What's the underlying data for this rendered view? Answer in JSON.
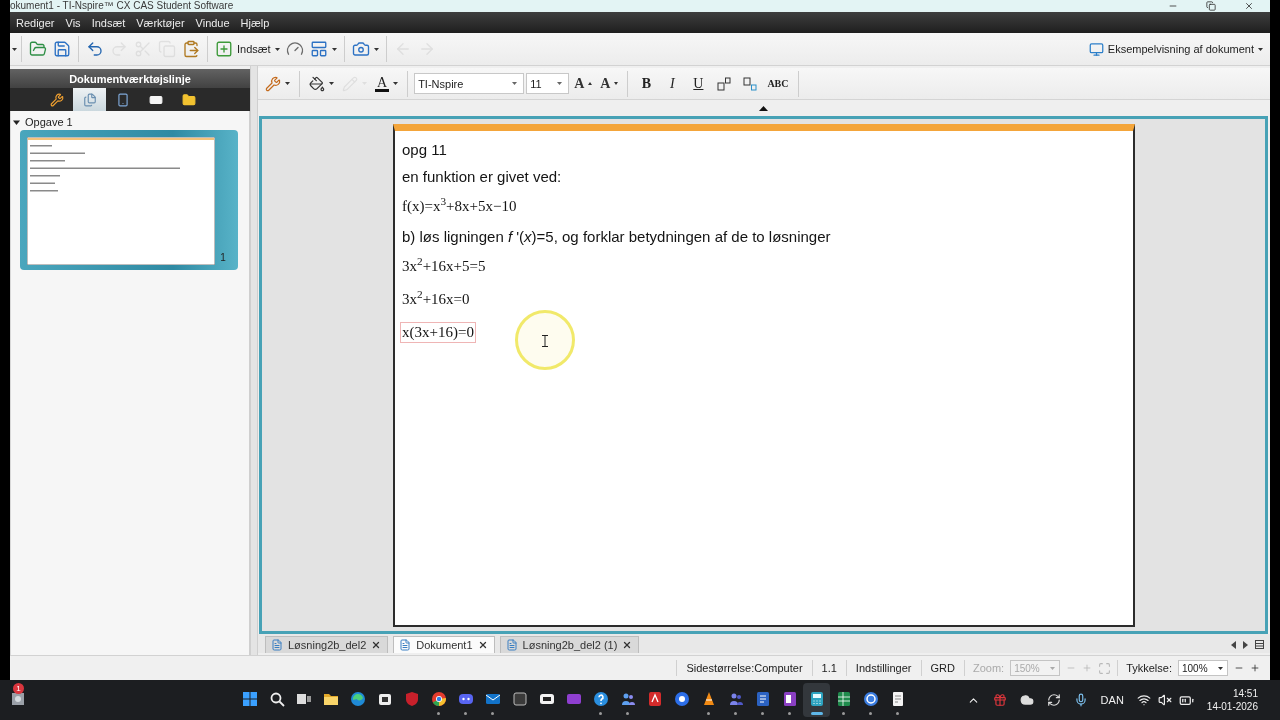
{
  "window": {
    "title": "okument1 - TI-Nspire™ CX CAS Student Software"
  },
  "menu_bar": [
    "Rediger",
    "Vis",
    "Indsæt",
    "Værktøjer",
    "Vindue",
    "Hjælp"
  ],
  "toolbar": {
    "buttons": [
      {
        "disabled": false,
        "menu": false
      },
      {
        "disabled": false,
        "menu": false
      },
      {
        "disabled": false,
        "menu": false
      },
      {
        "disabled": true,
        "menu": false
      },
      {
        "disabled": true,
        "menu": false
      },
      {
        "disabled": true,
        "menu": false
      },
      {
        "disabled": false,
        "menu": false
      },
      {
        "label": "Indsæt",
        "disabled": false,
        "menu": true
      },
      {
        "disabled": false,
        "menu": false
      },
      {
        "disabled": false,
        "menu": true
      },
      {
        "disabled": false,
        "menu": true
      },
      {
        "disabled": true,
        "menu": false
      },
      {
        "disabled": true,
        "menu": false
      }
    ],
    "preview": {
      "label": "Eksempelvisning af dokument",
      "menu": true
    }
  },
  "document_toolbar": {
    "title": "Dokumentværktøjslinje",
    "tabs": [
      {
        "selected": false
      },
      {
        "selected": true
      },
      {
        "selected": false
      },
      {
        "selected": false
      },
      {
        "selected": false
      }
    ]
  },
  "page_sorter": {
    "problems": [
      {
        "label": "Opgave 1",
        "expanded": true,
        "pages": [
          {
            "number": "1",
            "selected": true
          }
        ]
      }
    ]
  },
  "format_toolbar": {
    "tools": [
      {
        "disabled": false
      },
      {
        "disabled": false
      },
      {
        "disabled": true
      },
      {
        "label": "A",
        "disabled": false
      }
    ],
    "font": "TI-Nspire",
    "size": "11",
    "size_buttons": [
      {
        "label": "A",
        "kind": "grow"
      },
      {
        "label": "A",
        "kind": "shrink"
      }
    ],
    "style_buttons": [
      {
        "label": "B",
        "kind": "bold"
      },
      {
        "label": "I",
        "kind": "italic"
      },
      {
        "label": "U",
        "kind": "underline"
      }
    ],
    "script_buttons": [
      {
        "kind": "superscript"
      },
      {
        "kind": "subscript"
      }
    ],
    "spell_label": "ABC"
  },
  "document": {
    "lines": [
      {
        "kind": "text",
        "text": "opg 11",
        "focused": false
      },
      {
        "kind": "text",
        "text": "en funktion er givet ved:",
        "focused": false
      },
      {
        "kind": "math",
        "text": "f(x)=x$^{3}$+8x+5x−10",
        "focused": false
      },
      {
        "kind": "text",
        "text": "b) løs ligningen *f* '(*x*)=5, og forklar betydningen af de to løsninger",
        "focused": false
      },
      {
        "kind": "math",
        "text": "3x$^{2}$+16x+5=5",
        "focused": false
      },
      {
        "kind": "math",
        "text": "3x$^{2}$+16x=0",
        "focused": false
      },
      {
        "kind": "math",
        "text": "x(3x+16)=0",
        "focused": true
      }
    ]
  },
  "document_tabs": [
    {
      "label": "Løsning2b_del2",
      "selected": false
    },
    {
      "label": "Dokument1",
      "selected": true
    },
    {
      "label": "Løsning2b_del2 (1)",
      "selected": false
    }
  ],
  "status_bar": {
    "page_size": "Sidestørrelse:Computer",
    "page_number": "1.1",
    "settings": "Indstillinger",
    "angle": "GRD",
    "zoom": {
      "label": "Zoom:",
      "value": "150%",
      "disabled": true
    },
    "thickness": {
      "label": "Tykkelse:",
      "value": "100%",
      "disabled": false
    }
  },
  "taskbar": {
    "badge": "1",
    "apps": [
      {
        "running": false,
        "selected": false
      },
      {
        "running": false,
        "selected": false
      },
      {
        "running": false,
        "selected": false
      },
      {
        "running": false,
        "selected": false
      },
      {
        "running": false,
        "selected": false
      },
      {
        "running": false,
        "selected": false
      },
      {
        "running": false,
        "selected": false
      },
      {
        "running": true,
        "selected": false
      },
      {
        "running": true,
        "selected": false
      },
      {
        "running": true,
        "selected": false
      },
      {
        "running": false,
        "selected": false
      },
      {
        "running": false,
        "selected": false
      },
      {
        "running": false,
        "selected": false
      },
      {
        "running": true,
        "selected": false
      },
      {
        "running": true,
        "selected": false
      },
      {
        "running": false,
        "selected": false
      },
      {
        "running": false,
        "selected": false
      },
      {
        "running": true,
        "selected": false
      },
      {
        "running": true,
        "selected": false
      },
      {
        "running": true,
        "selected": false
      },
      {
        "running": true,
        "selected": false
      },
      {
        "running": true,
        "selected": true
      },
      {
        "running": true,
        "selected": false
      },
      {
        "running": true,
        "selected": false
      },
      {
        "running": true,
        "selected": false
      }
    ],
    "language": "DAN",
    "time": "14:51",
    "date": "14-01-2026"
  }
}
